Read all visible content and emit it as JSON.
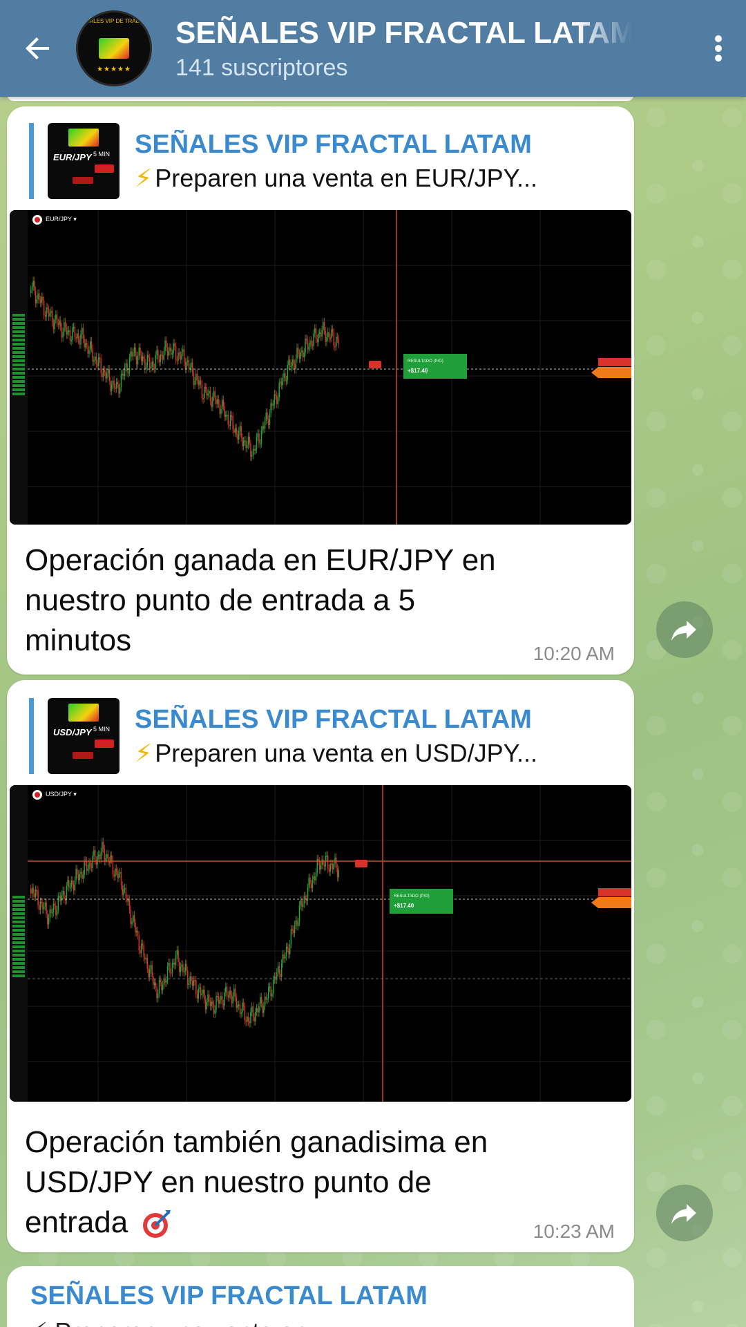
{
  "header": {
    "title": "SEÑALES VIP FRACTAL LATAM",
    "subscribers": "141 suscriptores",
    "avatar_stars": "★★★★★",
    "avatar_ring_text": "SEÑALES VIP DE TRADING"
  },
  "messages": [
    {
      "reply_name": "SEÑALES VIP FRACTAL LATAM",
      "reply_text": "Preparen una venta en EUR/JPY...",
      "reply_pair": "EUR/JPY",
      "chart": {
        "pair": "EUR/JPY ▾",
        "result_label": "RESULTADO (P/G)",
        "result_value": "+$17.40"
      },
      "caption": "Operación ganada en EUR/JPY en nuestro punto de entrada a 5 minutos",
      "time": "10:20 AM"
    },
    {
      "reply_name": "SEÑALES VIP FRACTAL LATAM",
      "reply_text": "Preparen una venta en USD/JPY...",
      "reply_pair": "USD/JPY",
      "chart": {
        "pair": "USD/JPY ▾",
        "result_label": "RESULTADO (P/G)",
        "result_value": "+$17.40"
      },
      "caption": "Operación también ganadisima en USD/JPY en nuestro punto de entrada",
      "time": "10:23 AM"
    }
  ],
  "next_message": {
    "name": "SEÑALES VIP FRACTAL LATAM",
    "snippet": "⚡ Preparen una venta en"
  },
  "colors": {
    "header_bg": "#527da3",
    "accent_name": "#3a8ad0",
    "reply_bar": "#4b9ad8",
    "bolt": "#f5b800",
    "candle_up": "#1fa83a",
    "candle_down": "#d8332a",
    "result_badge": "#1f9e3a"
  },
  "icons": [
    "back-arrow-icon",
    "more-vert-icon",
    "share-icon",
    "lightning-icon",
    "target-icon"
  ]
}
